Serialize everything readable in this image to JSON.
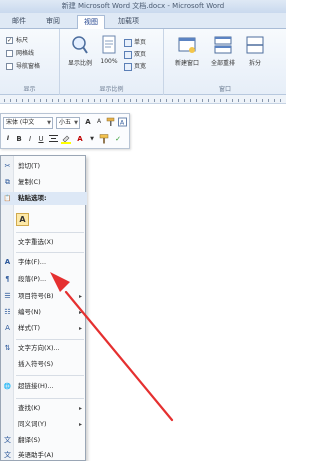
{
  "title_bar": {
    "text": "新建 Microsoft Word 文档.docx - Microsoft Word"
  },
  "ribbon_tabs": [
    {
      "label": "邮件"
    },
    {
      "label": "审阅"
    },
    {
      "label": "视图",
      "active": true
    },
    {
      "label": "加载项"
    }
  ],
  "ribbon": {
    "show_group": {
      "label": "显示",
      "checkboxes": [
        {
          "label": "标尺",
          "checked": true
        },
        {
          "label": "网格线",
          "checked": false
        },
        {
          "label": "导航窗格",
          "checked": false
        }
      ]
    },
    "zoom_group": {
      "label": "显示比例",
      "buttons": {
        "zoom": "显示比例",
        "hundred": "100%",
        "single": "单页",
        "double": "双页",
        "page_width": "页宽"
      }
    },
    "window_group": {
      "label": "窗口",
      "buttons": {
        "new_window": "新建窗口",
        "arrange_all": "全部重排",
        "split": "拆分"
      }
    }
  },
  "mini_toolbar": {
    "font_name": "宋体 (中文",
    "font_size": "小五",
    "buttons": [
      "A",
      "A",
      "I",
      "B",
      "I",
      "U",
      "A"
    ]
  },
  "context_menu": {
    "items": [
      {
        "label": "剪切(T)",
        "icon": "scissors-icon",
        "glyph": "✂"
      },
      {
        "label": "复制(C)",
        "icon": "copy-icon",
        "glyph": "⧉"
      },
      {
        "label": "粘贴选项:",
        "icon": "paste-icon",
        "glyph": "📋",
        "bold": true
      },
      {
        "label": "文字重选(X)",
        "icon": "",
        "glyph": ""
      },
      {
        "label": "字体(F)...",
        "icon": "font-icon",
        "glyph": "A"
      },
      {
        "label": "段落(P)...",
        "icon": "paragraph-icon",
        "glyph": "¶"
      },
      {
        "label": "项目符号(B)",
        "icon": "bullets-icon",
        "glyph": "☰",
        "submenu": true
      },
      {
        "label": "编号(N)",
        "icon": "numbering-icon",
        "glyph": "☷",
        "submenu": true
      },
      {
        "label": "样式(T)",
        "icon": "styles-icon",
        "glyph": "A",
        "submenu": true
      },
      {
        "label": "文字方向(X)...",
        "icon": "text-direction-icon",
        "glyph": "⇅"
      },
      {
        "label": "插入符号(S)",
        "icon": "",
        "glyph": ""
      },
      {
        "label": "超链接(H)...",
        "icon": "hyperlink-icon",
        "glyph": "🌐"
      },
      {
        "label": "查找(K)",
        "icon": "",
        "glyph": "",
        "submenu": true
      },
      {
        "label": "同义词(Y)",
        "icon": "",
        "glyph": "",
        "submenu": true
      },
      {
        "label": "翻译(S)",
        "icon": "translate-icon",
        "glyph": "文"
      },
      {
        "label": "英语助手(A)",
        "icon": "english-assistant-icon",
        "glyph": "文"
      }
    ],
    "paste_option_label": "A"
  },
  "colors": {
    "accent": "#2b579a",
    "arrow": "#e53030",
    "ribbon_bg": "#e6eef8"
  }
}
